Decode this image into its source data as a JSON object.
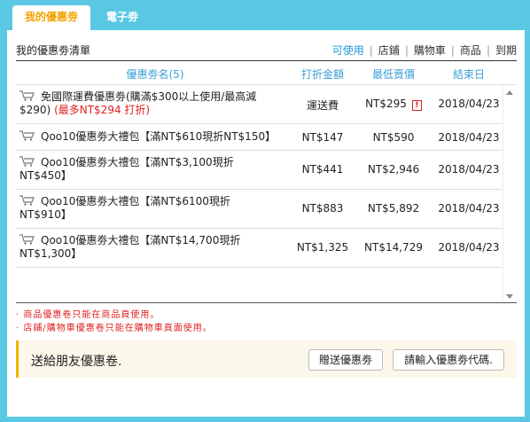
{
  "tabs": [
    {
      "label": "我的優惠劵",
      "active": true
    },
    {
      "label": "電子劵",
      "active": false
    }
  ],
  "list_title": "我的優惠劵清單",
  "filters": [
    "可使用",
    "店鋪",
    "購物車",
    "商品",
    "到期"
  ],
  "columns": {
    "name": "優惠劵名(5)",
    "discount": "打折金額",
    "min_price": "最低賣價",
    "end": "結束日"
  },
  "coupons": [
    {
      "name_line1": "免國際運費優惠劵(購滿$300以上使用/最高減",
      "name_line2": "$290)",
      "name_red": "(最多NT$294 打折)",
      "discount": "運送費",
      "min_price": "NT$295",
      "warning": true,
      "end": "2018/04/23"
    },
    {
      "name_line1": "Qoo10優惠劵大禮包【滿NT$610現折NT$150】",
      "name_line2": "",
      "name_red": "",
      "discount": "NT$147",
      "min_price": "NT$590",
      "warning": false,
      "end": "2018/04/23"
    },
    {
      "name_line1": "Qoo10優惠劵大禮包【滿NT$3,100現折",
      "name_line2": "NT$450】",
      "name_red": "",
      "discount": "NT$441",
      "min_price": "NT$2,946",
      "warning": false,
      "end": "2018/04/23"
    },
    {
      "name_line1": "Qoo10優惠劵大禮包【滿NT$6100現折",
      "name_line2": "NT$910】",
      "name_red": "",
      "discount": "NT$883",
      "min_price": "NT$5,892",
      "warning": false,
      "end": "2018/04/23"
    },
    {
      "name_line1": "Qoo10優惠劵大禮包【滿NT$14,700現折",
      "name_line2": "NT$1,300】",
      "name_red": "",
      "discount": "NT$1,325",
      "min_price": "NT$14,729",
      "warning": false,
      "end": "2018/04/23"
    }
  ],
  "warning_glyph": "!",
  "notes": [
    "· 商品優惠卷只能在商品頁使用。",
    "· 店鋪/購物車優惠卷只能在購物車頁面使用。"
  ],
  "share": {
    "text": "送給朋友優惠卷.",
    "gift_button": "贈送優惠劵",
    "code_button": "請輸入優惠劵代碼."
  },
  "colors": {
    "header_bg": "#5ac8e3",
    "active_tab_text": "#f4a300",
    "link_blue": "#3a9fd6",
    "red": "#e02020",
    "share_accent": "#f0b400"
  },
  "icons": {
    "cart": "shopping-cart-icon",
    "warning": "warning-icon"
  }
}
